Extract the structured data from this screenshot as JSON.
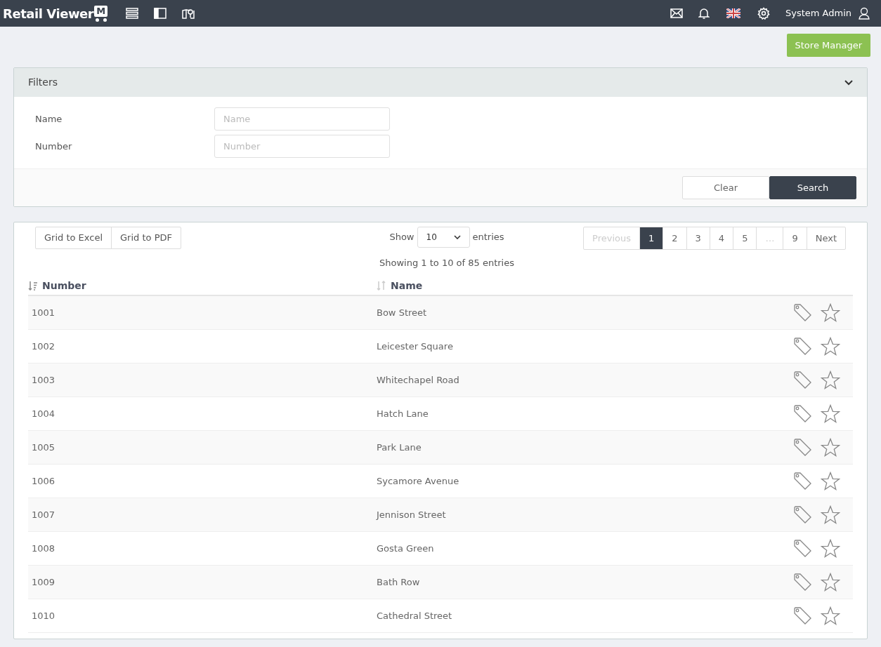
{
  "logo": {
    "text": "Retail Viewer",
    "mark": "M"
  },
  "user": {
    "name": "System Admin"
  },
  "primary_button": "Store Manager",
  "filters": {
    "title": "Filters",
    "expanded": true,
    "fields": [
      {
        "label": "Name",
        "placeholder": "Name"
      },
      {
        "label": "Number",
        "placeholder": "Number"
      }
    ],
    "buttons": [
      {
        "label": "Clear",
        "kind": "secondary"
      },
      {
        "label": "Search",
        "kind": "primary"
      }
    ]
  },
  "export_buttons": [
    "Grid to Excel",
    "Grid to PDF"
  ],
  "length": {
    "prefix": "Show",
    "value": "10",
    "suffix": "entries"
  },
  "info": "Showing 1 to 10 of 85 entries",
  "pagination": [
    {
      "label": "Previous",
      "selected": false,
      "disabled": true
    },
    {
      "label": "1",
      "selected": true,
      "disabled": false
    },
    {
      "label": "2",
      "selected": false,
      "disabled": false
    },
    {
      "label": "3",
      "selected": false,
      "disabled": false
    },
    {
      "label": "4",
      "selected": false,
      "disabled": false
    },
    {
      "label": "5",
      "selected": false,
      "disabled": false
    },
    {
      "label": "…",
      "selected": false,
      "disabled": true
    },
    {
      "label": "9",
      "selected": false,
      "disabled": false
    },
    {
      "label": "Next",
      "selected": false,
      "disabled": false
    }
  ],
  "table": {
    "columns": [
      {
        "label": "Number",
        "sorted": true
      },
      {
        "label": "Name",
        "sorted": false
      }
    ],
    "rows": [
      {
        "number": "1001",
        "name": "Bow Street",
        "starred": false
      },
      {
        "number": "1002",
        "name": "Leicester Square",
        "starred": false
      },
      {
        "number": "1003",
        "name": "Whitechapel Road",
        "starred": false
      },
      {
        "number": "1004",
        "name": "Hatch Lane",
        "starred": false
      },
      {
        "number": "1005",
        "name": "Park Lane",
        "starred": false
      },
      {
        "number": "1006",
        "name": "Sycamore Avenue",
        "starred": false
      },
      {
        "number": "1007",
        "name": "Jennison Street",
        "starred": false
      },
      {
        "number": "1008",
        "name": "Gosta Green",
        "starred": false
      },
      {
        "number": "1009",
        "name": "Bath Row",
        "starred": false
      },
      {
        "number": "1010",
        "name": "Cathedral Street",
        "starred": false
      }
    ]
  }
}
